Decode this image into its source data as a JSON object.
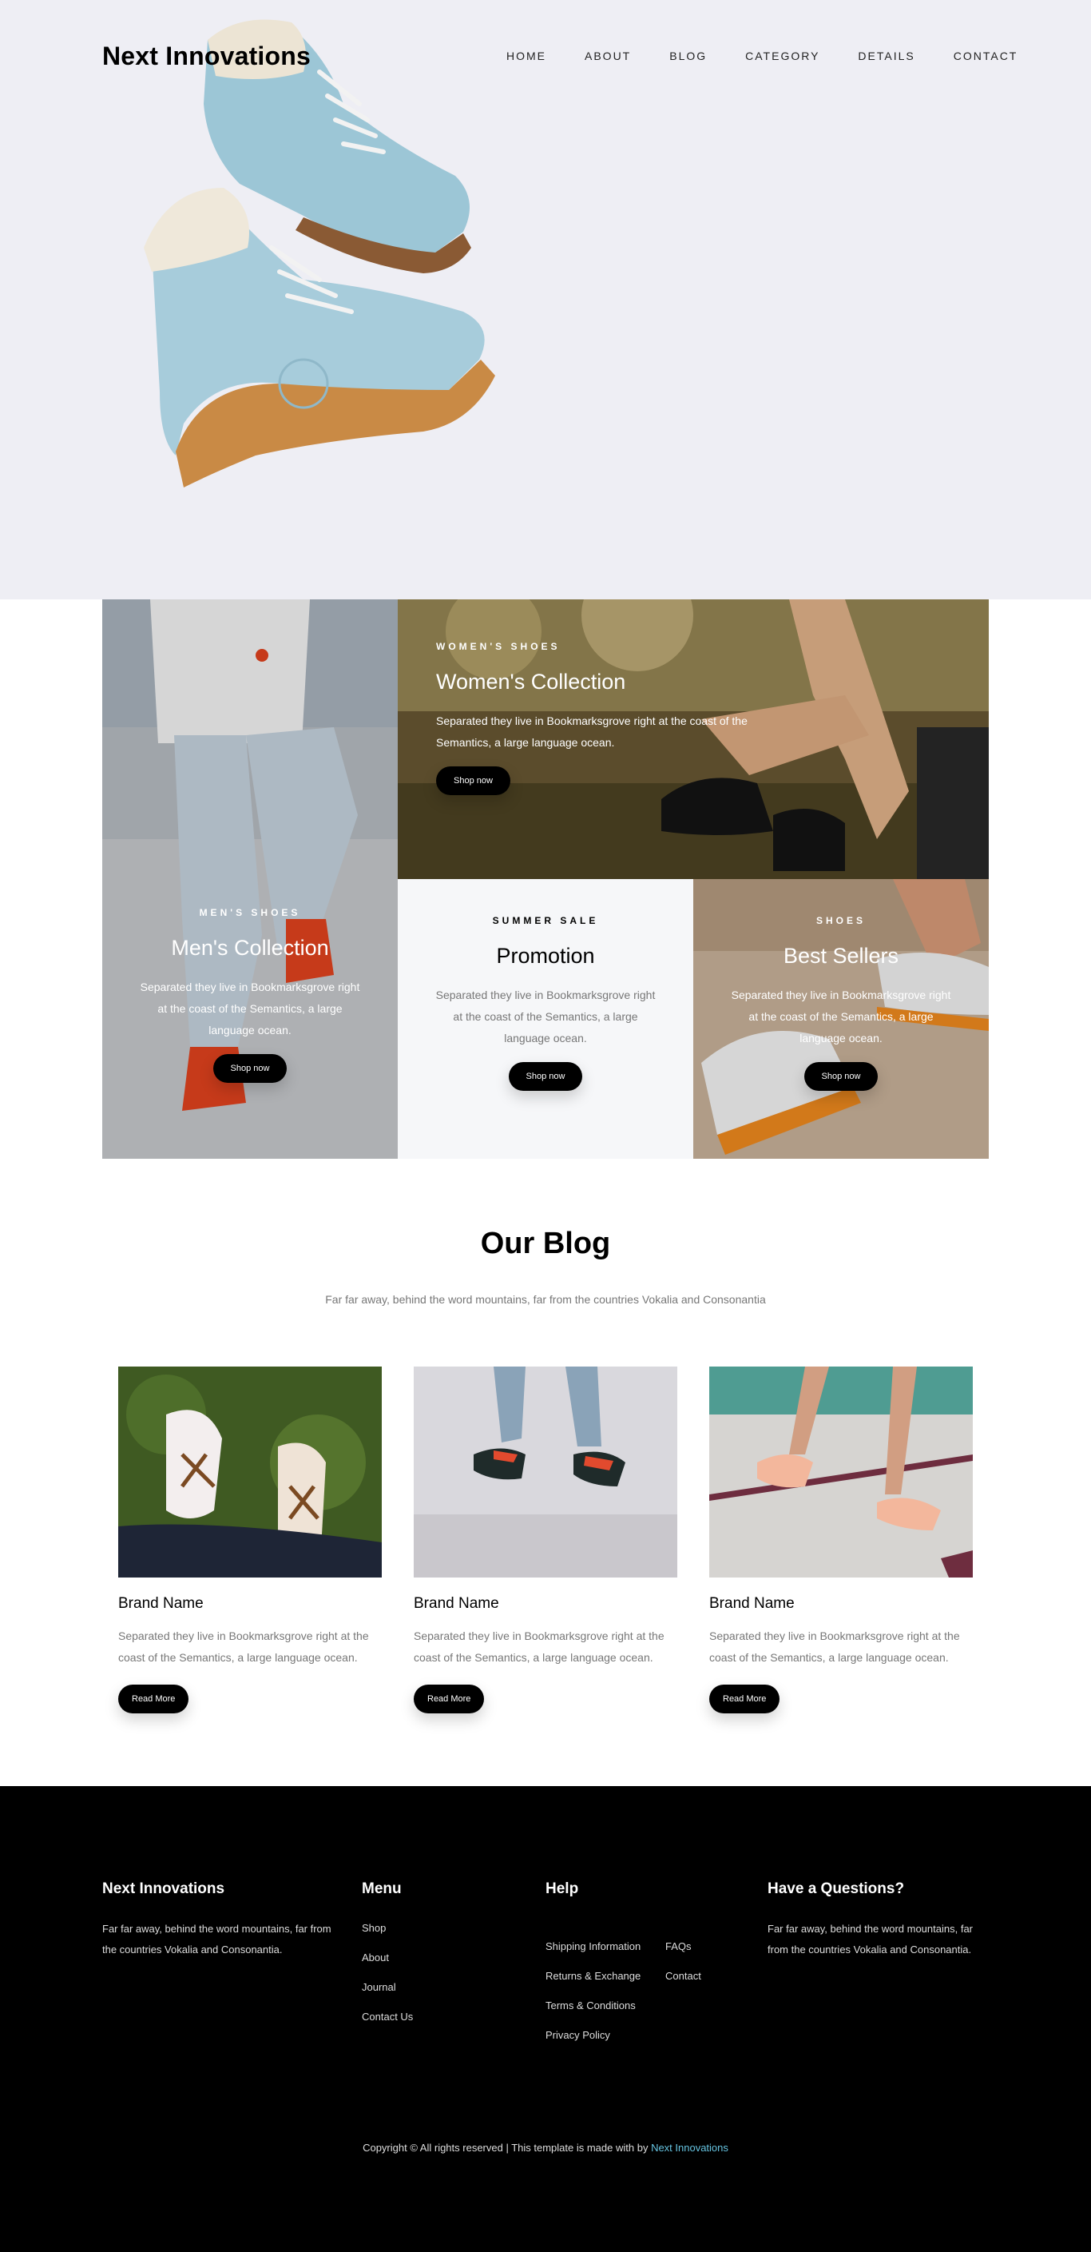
{
  "brand": "Next Innovations",
  "nav": [
    "HOME",
    "ABOUT",
    "BLOG",
    "CATEGORY",
    "DETAILS",
    "CONTACT"
  ],
  "collections": {
    "men": {
      "kicker": "MEN'S SHOES",
      "title": "Men's Collection",
      "text": "Separated they live in Bookmarksgrove right at the coast of the Semantics, a large language ocean.",
      "button": "Shop now"
    },
    "women": {
      "kicker": "WOMEN'S SHOES",
      "title": "Women's Collection",
      "text": "Separated they live in Bookmarksgrove right at the coast of the Semantics, a large language ocean.",
      "button": "Shop now"
    },
    "promo": {
      "kicker": "SUMMER SALE",
      "title": "Promotion",
      "text": "Separated they live in Bookmarksgrove right at the coast of the Semantics, a large language ocean.",
      "button": "Shop now"
    },
    "best": {
      "kicker": "SHOES",
      "title": "Best Sellers",
      "text": "Separated they live in Bookmarksgrove right at the coast of the Semantics, a large language ocean.",
      "button": "Shop now"
    }
  },
  "blog": {
    "title": "Our Blog",
    "subtitle": "Far far away, behind the word mountains, far from the countries Vokalia and Consonantia",
    "cards": [
      {
        "title": "Brand Name",
        "text": "Separated they live in Bookmarksgrove right at the coast of the Semantics, a large language ocean.",
        "button": "Read More"
      },
      {
        "title": "Brand Name",
        "text": "Separated they live in Bookmarksgrove right at the coast of the Semantics, a large language ocean.",
        "button": "Read More"
      },
      {
        "title": "Brand Name",
        "text": "Separated they live in Bookmarksgrove right at the coast of the Semantics, a large language ocean.",
        "button": "Read More"
      }
    ]
  },
  "footer": {
    "about": {
      "title": "Next Innovations",
      "text": "Far far away, behind the word mountains, far from the countries Vokalia and Consonantia."
    },
    "menu": {
      "title": "Menu",
      "items": [
        "Shop",
        "About",
        "Journal",
        "Contact Us"
      ]
    },
    "help": {
      "title": "Help",
      "col1": [
        "Shipping Information",
        "Returns & Exchange",
        "Terms & Conditions",
        "Privacy Policy"
      ],
      "col2": [
        "FAQs",
        "Contact"
      ]
    },
    "questions": {
      "title": "Have a Questions?",
      "text": "Far far away, behind the word mountains, far from the countries Vokalia and Consonantia."
    },
    "copyright_prefix": "Copyright © All rights reserved | This template is made with by ",
    "copyright_link": "Next Innovations",
    "link_color": "#66c3e0"
  }
}
